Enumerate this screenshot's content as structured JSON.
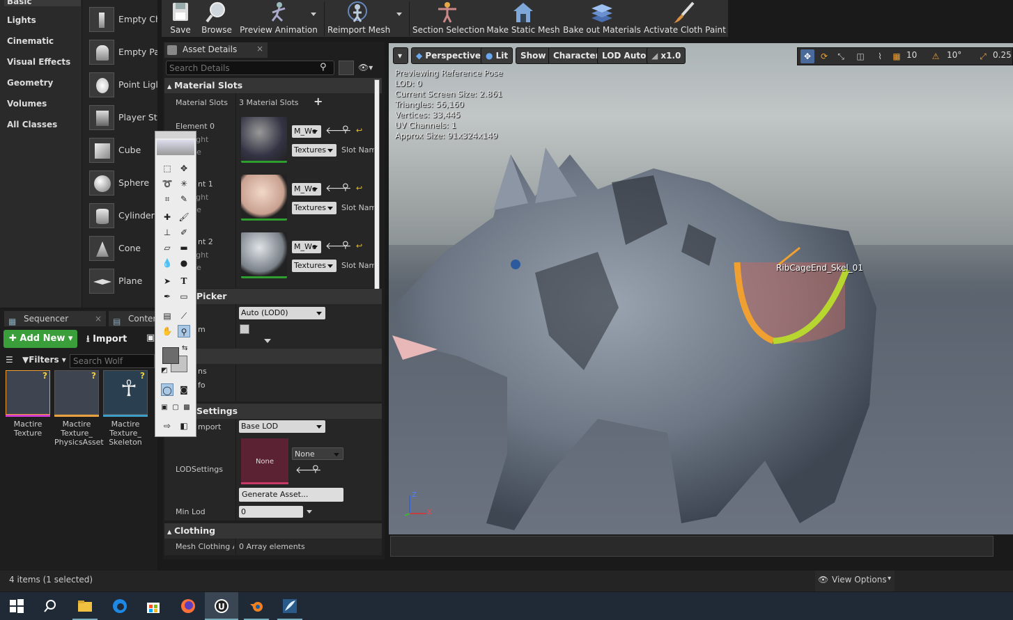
{
  "place_actors": {
    "categories": [
      "Basic",
      "Lights",
      "Cinematic",
      "Visual Effects",
      "Geometry",
      "Volumes",
      "All Classes"
    ],
    "actors": [
      "Empty Ch",
      "Empty Pa",
      "Point Ligl",
      "Player St",
      "Cube",
      "Sphere",
      "Cylinder",
      "Cone",
      "Plane"
    ]
  },
  "toolbar": {
    "save": "Save",
    "browse": "Browse",
    "preview_animation": "Preview Animation",
    "reimport_mesh": "Reimport Mesh",
    "section_selection": "Section Selection",
    "make_static_mesh": "Make Static Mesh",
    "bake_out_materials": "Bake out Materials",
    "activate_cloth_paint": "Activate Cloth Paint"
  },
  "details": {
    "tab_label": "Asset Details",
    "search_placeholder": "Search Details",
    "material_slots_section": "Material Slots",
    "material_slots_label": "Material Slots",
    "material_slots_count": "3 Material Slots",
    "elements": [
      {
        "label": "Element 0",
        "highlight": "hlight",
        "isolate": "late",
        "material": "M_Wc",
        "textures": "Textures",
        "slot_name": "Slot Nam"
      },
      {
        "label": "nt 1",
        "highlight": "hlight",
        "isolate": "late",
        "material": "M_Wc",
        "textures": "Textures",
        "slot_name": "Slot Nam"
      },
      {
        "label": "nt 2",
        "highlight": "hlight",
        "isolate": "late",
        "material": "M_Wc",
        "textures": "Textures",
        "slot_name": "Slot Nam"
      }
    ],
    "lod_picker_section": "Picker",
    "lod_picker_value": "Auto (LOD0)",
    "lod_custom_label": "m",
    "lod_info_1": "ns",
    "lod_info_2": "fo",
    "settings_section": "Settings",
    "import_label": "mport",
    "import_value": "Base LOD",
    "lodsettings_label": "LODSettings",
    "lodsettings_thumb": "None",
    "lodsettings_value": "None",
    "generate_asset": "Generate Asset...",
    "min_lod_label": "Min Lod",
    "min_lod_value": "0",
    "clothing_section": "Clothing",
    "mesh_clothing_label": "Mesh Clothing As",
    "mesh_clothing_value": "0 Array elements"
  },
  "viewport": {
    "perspective": "Perspective",
    "lit": "Lit",
    "show": "Show",
    "character": "Character",
    "lod_auto": "LOD Auto",
    "speed": "x1.0",
    "grid_snap": "10",
    "rot_snap": "10°",
    "scale_snap": "0.25",
    "stats": [
      "Previewing Reference Pose",
      "LOD: 0",
      "Current Screen Size: 2.861",
      "Triangles: 56,160",
      "Vertices: 33,445",
      "UV Channels: 1",
      "Approx Size: 91x324x149"
    ],
    "bone_label": "RibCageEnd_Skel_01",
    "axis_z": "Z",
    "axis_x": "X"
  },
  "content_browser": {
    "sequencer_tab": "Sequencer",
    "content_tab": "Conten",
    "add_new": "Add New",
    "import": "Import",
    "filters": "Filters",
    "search_placeholder": "Search Wolf",
    "assets": [
      {
        "name": "Mactire Texture",
        "bar_color": "#d23ed2"
      },
      {
        "name": "Mactire Texture_ PhysicsAsset",
        "bar_color": "#e8a040"
      },
      {
        "name": "Mactire Texture_ Skeleton",
        "bar_color": "#3e9ec8"
      }
    ],
    "item_count": "4 items (1 selected)",
    "view_options": "View Options"
  },
  "colors": {
    "accent_green": "#3a9e3a",
    "selection_orange": "#f0a030",
    "bone_green": "#b8d630"
  }
}
